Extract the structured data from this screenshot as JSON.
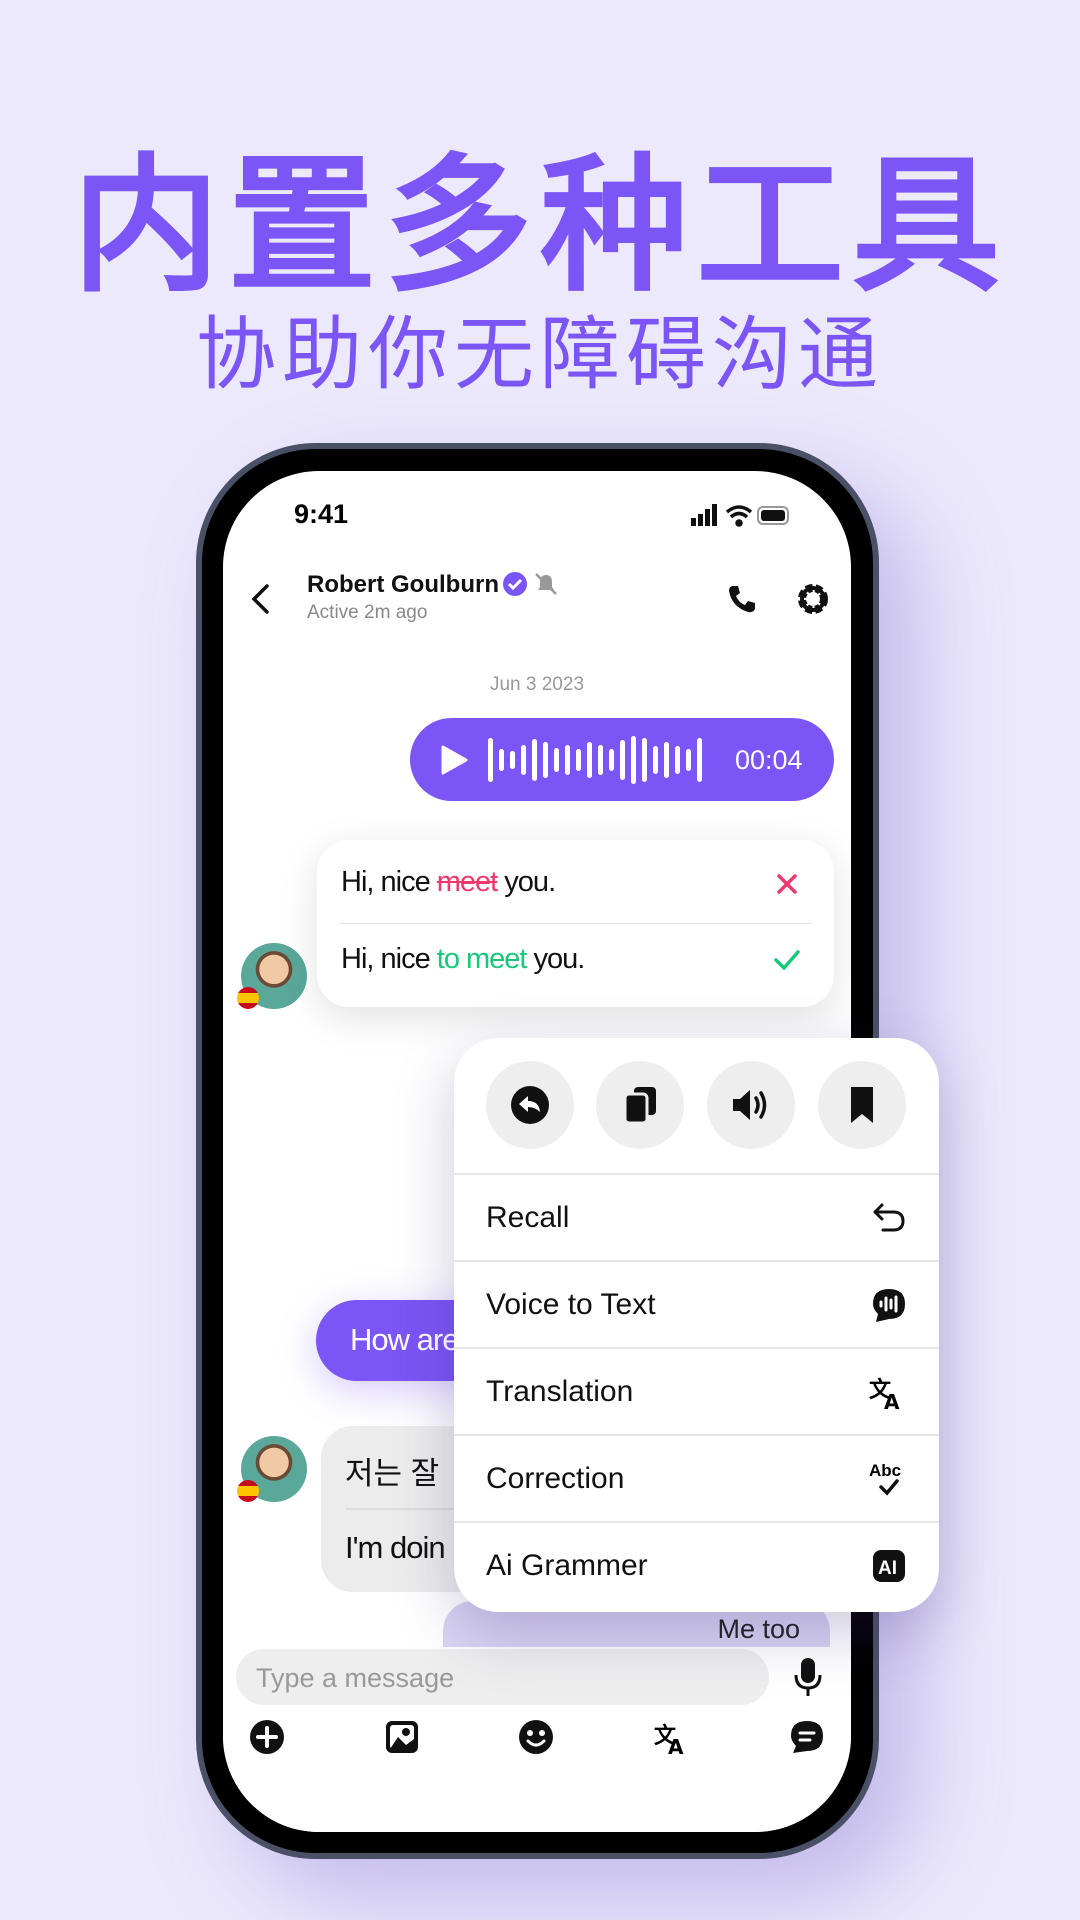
{
  "headline": "内置多种工具",
  "subheadline": "协助你无障碍沟通",
  "status": {
    "time": "9:41"
  },
  "header": {
    "name": "Robert Goulburn",
    "status": "Active 2m ago",
    "verified_icon": "verified-badge-icon",
    "muted_icon": "bell-off-icon"
  },
  "date": "Jun 3 2023",
  "voice": {
    "duration": "00:04"
  },
  "correction": {
    "wrong_prefix": "Hi, nice ",
    "wrong_word": "meet",
    "wrong_suffix": " you.",
    "right_prefix": "Hi, nice ",
    "right_word": "to meet",
    "right_suffix": " you.",
    "wrong_color": "#f0386b",
    "right_color": "#18c77a"
  },
  "messages": {
    "sent1": "How are",
    "korean": "저는 잘",
    "english": "I'm doin",
    "sent2": "Me too"
  },
  "menu": {
    "items": [
      {
        "label": "Recall"
      },
      {
        "label": "Voice to Text"
      },
      {
        "label": "Translation"
      },
      {
        "label": "Correction"
      },
      {
        "label": "Ai Grammer"
      }
    ]
  },
  "input": {
    "placeholder": "Type a message"
  },
  "colors": {
    "accent": "#7b55f5",
    "background": "#ece9fd"
  }
}
